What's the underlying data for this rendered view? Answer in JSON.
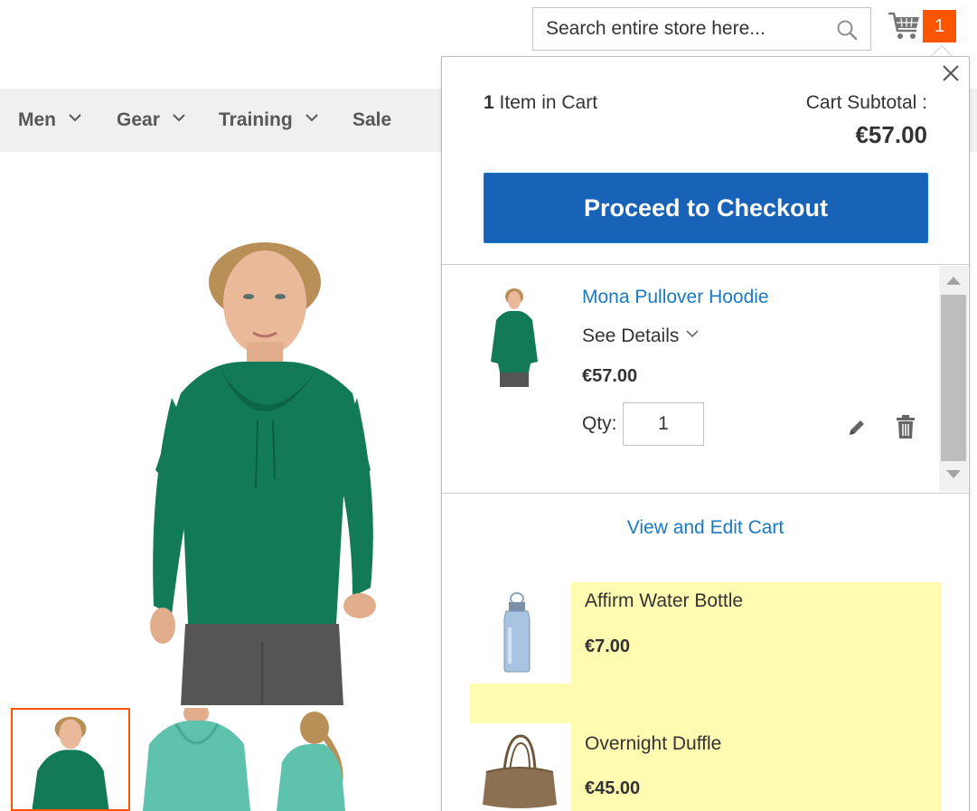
{
  "header": {
    "search_placeholder": "Search entire store here...",
    "cart_count": "1",
    "accent_color": "#ff5501"
  },
  "nav": {
    "items": [
      {
        "label": "Men",
        "has_dropdown": true
      },
      {
        "label": "Gear",
        "has_dropdown": true
      },
      {
        "label": "Training",
        "has_dropdown": true
      },
      {
        "label": "Sale",
        "has_dropdown": false
      }
    ]
  },
  "minicart": {
    "items_count": "1",
    "items_label": "Item in Cart",
    "subtotal_label": "Cart Subtotal :",
    "subtotal_value": "€57.00",
    "checkout_label": "Proceed to Checkout",
    "checkout_color": "#1862b8",
    "item": {
      "name": "Mona Pullover Hoodie",
      "details_label": "See Details",
      "price": "€57.00",
      "qty_label": "Qty:",
      "qty_value": "1"
    },
    "view_cart_label": "View and Edit Cart",
    "link_color": "#1979c3"
  },
  "related": [
    {
      "name": "Affirm Water Bottle",
      "price": "€7.00"
    },
    {
      "name": "Overnight Duffle",
      "price": "€45.00"
    }
  ],
  "highlight_color": "#fffbb1",
  "product_color": "#0f7a55"
}
